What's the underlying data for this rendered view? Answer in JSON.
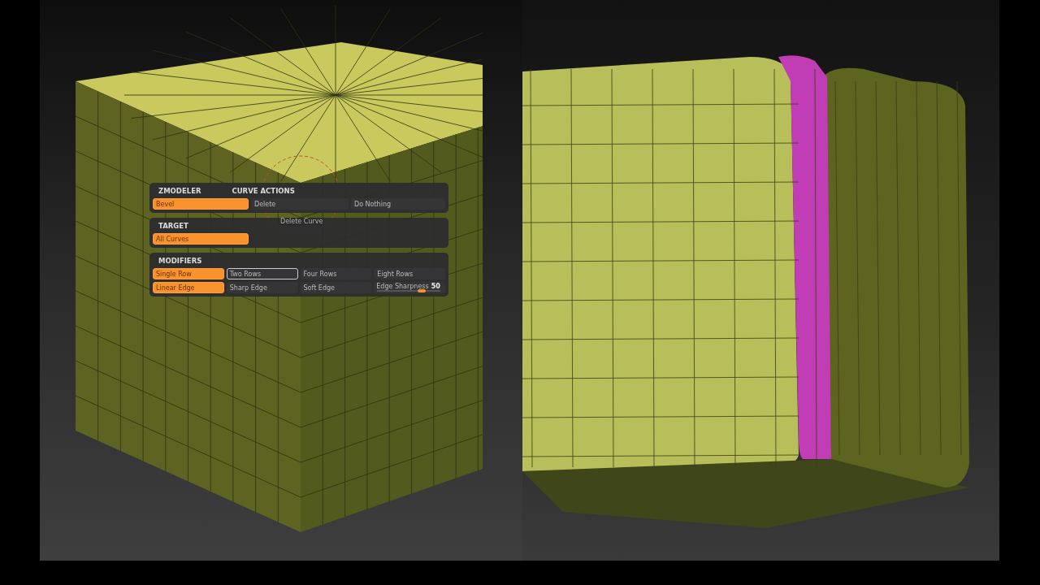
{
  "canvas_hint": "Delete Curve",
  "menu": {
    "sections": [
      {
        "title": "ZMODELER",
        "subtitle": "CURVE ACTIONS",
        "items": [
          {
            "kind": "toggle",
            "label": "Bevel",
            "selected": true,
            "hovered": false
          },
          {
            "kind": "toggle",
            "label": "Delete",
            "selected": false,
            "hovered": false
          },
          {
            "kind": "toggle",
            "label": "Do Nothing",
            "selected": false,
            "hovered": false
          }
        ]
      },
      {
        "title": "TARGET",
        "items": [
          {
            "kind": "toggle",
            "label": "All Curves",
            "selected": true,
            "hovered": false
          }
        ]
      },
      {
        "title": "MODIFIERS",
        "items": [
          {
            "kind": "toggle",
            "label": "Single Row",
            "selected": true,
            "hovered": false
          },
          {
            "kind": "toggle",
            "label": "Two Rows",
            "selected": false,
            "hovered": true
          },
          {
            "kind": "toggle",
            "label": "Four Rows",
            "selected": false,
            "hovered": false
          },
          {
            "kind": "toggle",
            "label": "Eight Rows",
            "selected": false,
            "hovered": false
          },
          {
            "kind": "toggle",
            "label": "Linear Edge",
            "selected": true,
            "hovered": false
          },
          {
            "kind": "toggle",
            "label": "Sharp Edge",
            "selected": false,
            "hovered": false
          },
          {
            "kind": "toggle",
            "label": "Soft Edge",
            "selected": false,
            "hovered": false
          },
          {
            "kind": "slider",
            "label": "Edge Sharpness",
            "value": "50",
            "level": 0.7
          }
        ]
      }
    ]
  }
}
